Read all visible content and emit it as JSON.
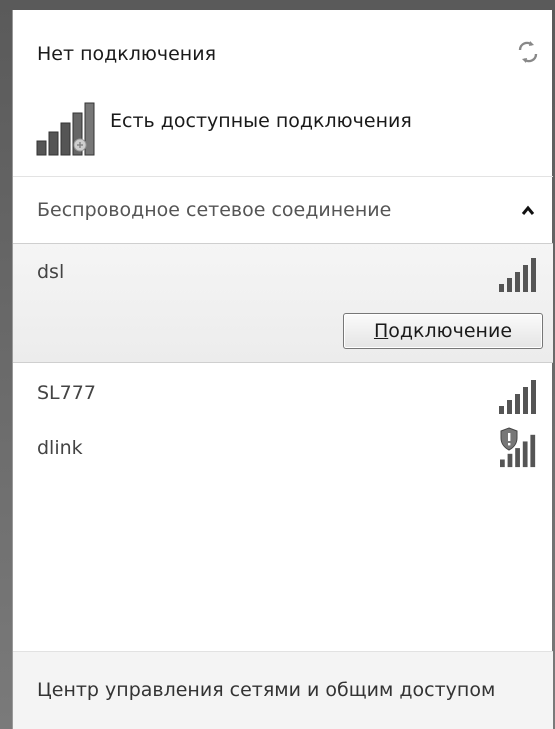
{
  "status": {
    "title": "Нет подключения",
    "available_text": "Есть доступные подключения"
  },
  "section": {
    "title": "Беспроводное сетевое соединение"
  },
  "networks": [
    {
      "name": "dsl",
      "selected": true,
      "secured_warning": false
    },
    {
      "name": "SL777",
      "selected": false,
      "secured_warning": false
    },
    {
      "name": "dlink",
      "selected": false,
      "secured_warning": true
    }
  ],
  "connect_button": {
    "hotkey": "П",
    "rest": "одключение"
  },
  "footer": {
    "link": "Центр управления сетями и общим доступом"
  },
  "icons": {
    "refresh": "refresh-icon",
    "available": "network-bars-available-icon",
    "collapse": "chevron-up-icon",
    "signal": "wifi-signal-icon",
    "shield_warning": "shield-warning-icon"
  }
}
